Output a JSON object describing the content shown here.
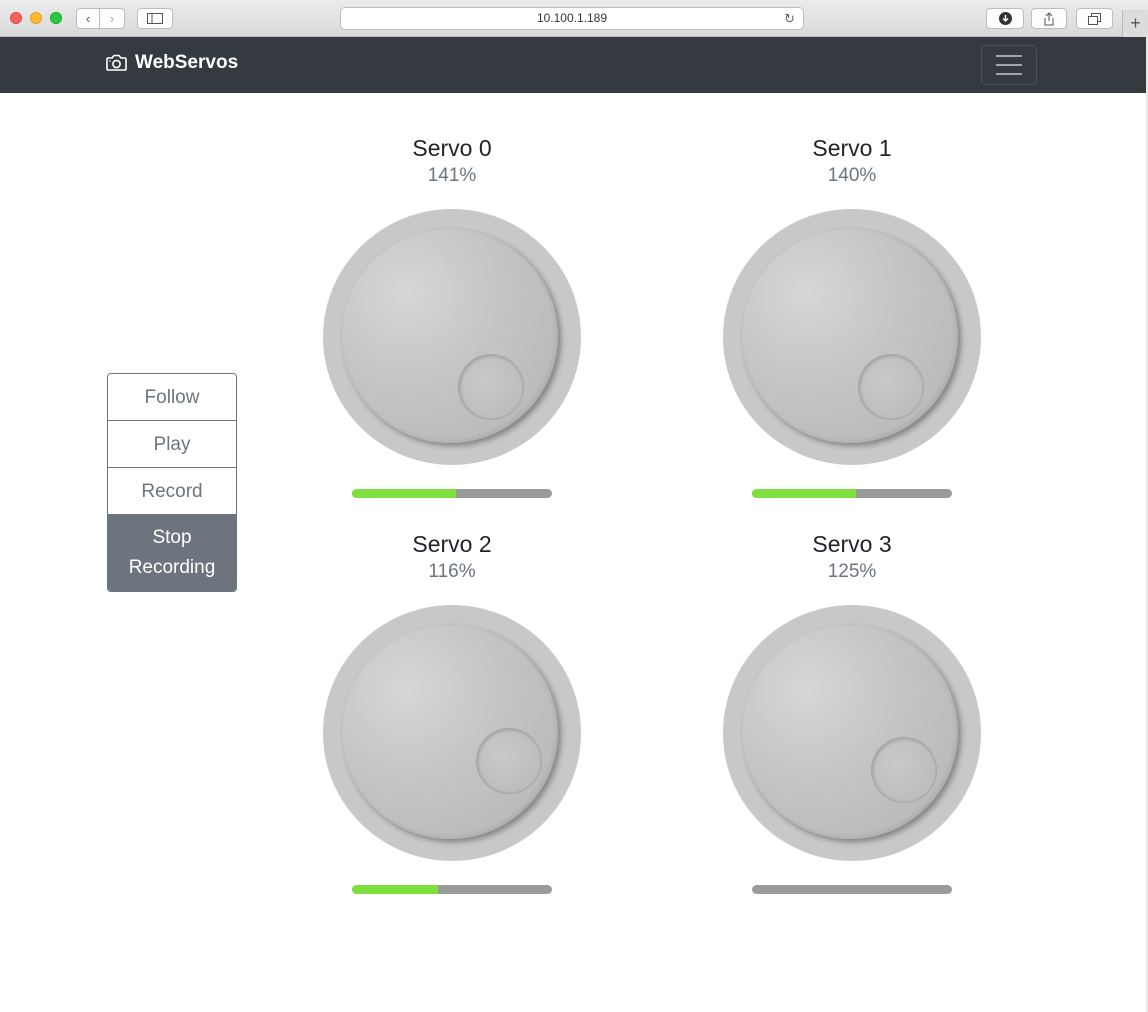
{
  "browser": {
    "url": "10.100.1.189"
  },
  "navbar": {
    "brand": "WebServos",
    "brand_icon": "camera-icon",
    "menu_icon": "hamburger-menu-icon"
  },
  "controls": {
    "follow": "Follow",
    "play": "Play",
    "record": "Record",
    "stop_recording_line1": "Stop",
    "stop_recording_line2": "Recording"
  },
  "servos": [
    {
      "title": "Servo 0",
      "value": "141%",
      "progress": 0.52
    },
    {
      "title": "Servo 1",
      "value": "140%",
      "progress": 0.52
    },
    {
      "title": "Servo 2",
      "value": "116%",
      "progress": 0.43
    },
    {
      "title": "Servo 3",
      "value": "125%",
      "progress": 0.0
    }
  ],
  "colors": {
    "navbar": "#343a40",
    "progress_fill": "#7fe03d",
    "progress_track": "#9a9a9a",
    "active_button": "#6c757d"
  }
}
